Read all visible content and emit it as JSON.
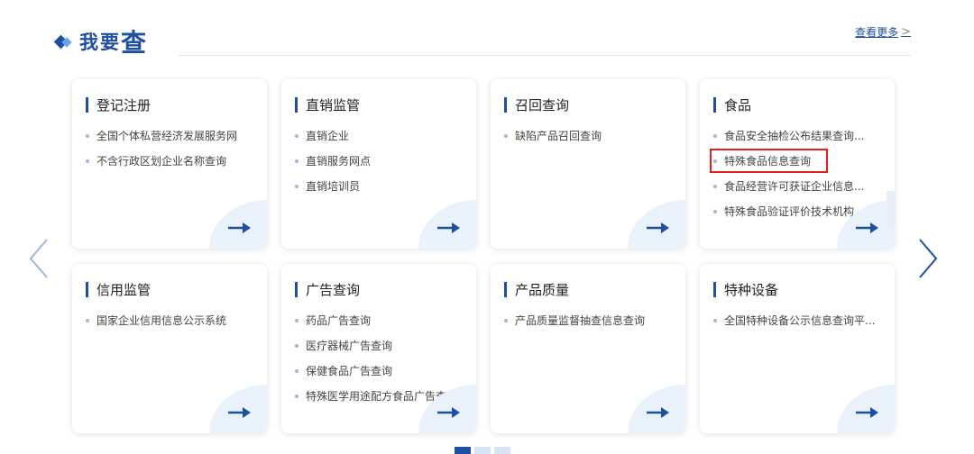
{
  "header": {
    "title_part1": "我要",
    "title_part2": "查",
    "more_label": "查看更多",
    "more_chevron": ">"
  },
  "colors": {
    "accent": "#1d4fa2",
    "highlight": "#e02020"
  },
  "cards": [
    {
      "title": "登记注册",
      "items": [
        "全国个体私营经济发展服务网",
        "不含行政区划企业名称查询"
      ]
    },
    {
      "title": "直销监管",
      "items": [
        "直销企业",
        "直销服务网点",
        "直销培训员"
      ]
    },
    {
      "title": "召回查询",
      "items": [
        "缺陷产品召回查询"
      ]
    },
    {
      "title": "食品",
      "items": [
        "食品安全抽检公布结果查询...",
        "特殊食品信息查询",
        "食品经营许可获证企业信息...",
        "特殊食品验证评价技术机构..."
      ]
    },
    {
      "title": "信用监管",
      "items": [
        "国家企业信用信息公示系统"
      ]
    },
    {
      "title": "广告查询",
      "items": [
        "药品广告查询",
        "医疗器械广告查询",
        "保健食品广告查询",
        "特殊医学用途配方食品广告查..."
      ]
    },
    {
      "title": "产品质量",
      "items": [
        "产品质量监督抽查信息查询"
      ]
    },
    {
      "title": "特种设备",
      "items": [
        "全国特种设备公示信息查询平..."
      ]
    }
  ],
  "icons": {
    "prev": "chevron-left-icon",
    "next": "chevron-right-icon",
    "go": "arrow-right-icon"
  }
}
